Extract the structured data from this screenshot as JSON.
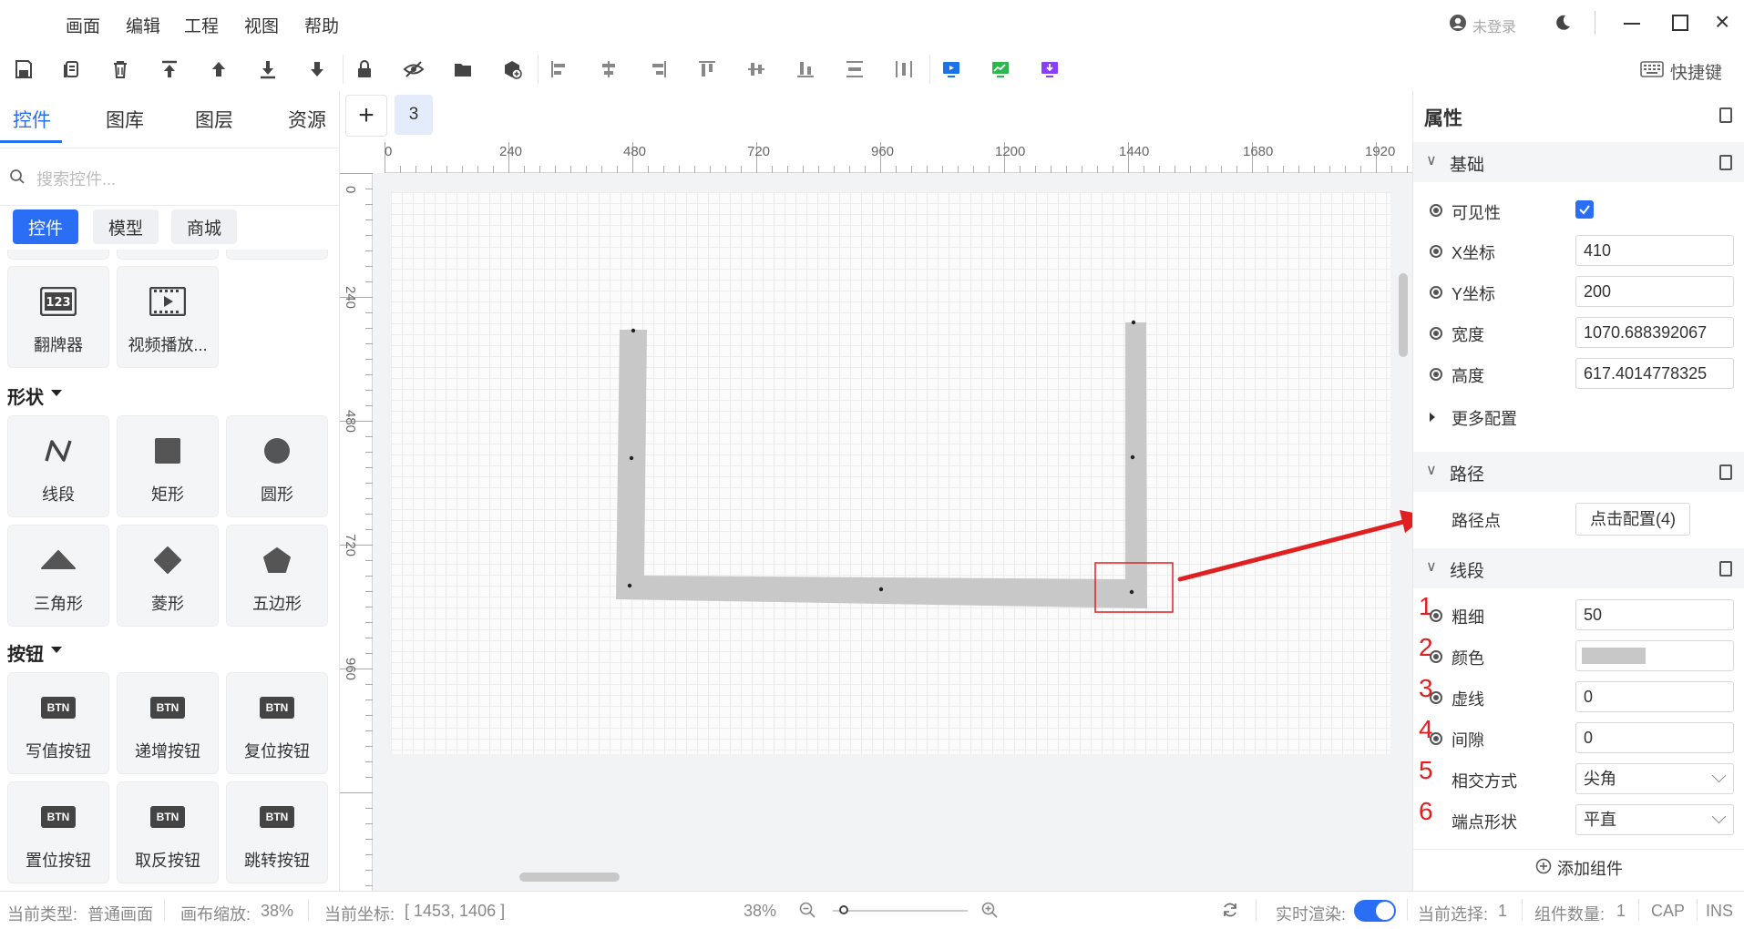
{
  "menu": {
    "items": [
      "画面",
      "编辑",
      "工程",
      "视图",
      "帮助"
    ],
    "user": "未登录"
  },
  "toolbar": {
    "shortcut_label": "快捷键"
  },
  "left_panel": {
    "tabs": [
      "控件",
      "图库",
      "图层",
      "资源"
    ],
    "search_placeholder": "搜索控件...",
    "chips": [
      "控件",
      "模型",
      "商城"
    ],
    "top_tiles": [
      {
        "label": "翻牌器",
        "icon": "flip-counter-icon"
      },
      {
        "label": "视频播放...",
        "icon": "video-player-icon"
      }
    ],
    "shapes_section": "形状",
    "shapes": [
      {
        "label": "线段",
        "icon": "polyline-icon"
      },
      {
        "label": "矩形",
        "icon": "rectangle-icon"
      },
      {
        "label": "圆形",
        "icon": "circle-icon"
      },
      {
        "label": "三角形",
        "icon": "triangle-icon"
      },
      {
        "label": "菱形",
        "icon": "diamond-icon"
      },
      {
        "label": "五边形",
        "icon": "pentagon-icon"
      }
    ],
    "buttons_section": "按钮",
    "buttons": [
      {
        "label": "写值按钮",
        "icon": "write-button-icon"
      },
      {
        "label": "递增按钮",
        "icon": "increment-button-icon"
      },
      {
        "label": "复位按钮",
        "icon": "reset-button-icon"
      },
      {
        "label": "置位按钮",
        "icon": "set-button-icon"
      },
      {
        "label": "取反按钮",
        "icon": "invert-button-icon"
      },
      {
        "label": "跳转按钮",
        "icon": "jump-button-icon"
      }
    ],
    "btn_text": "BTN"
  },
  "canvas": {
    "add_page": "+",
    "page_tab": "3",
    "hruler_ticks": [
      "0",
      "240",
      "480",
      "720",
      "960",
      "1200",
      "1440",
      "1680",
      "1920"
    ],
    "vruler_ticks": [
      "0",
      "240",
      "480",
      "720",
      "960"
    ]
  },
  "right_panel": {
    "title": "属性",
    "basic_section": "基础",
    "visible_label": "可见性",
    "visible": true,
    "x_label": "X坐标",
    "x_value": "410",
    "y_label": "Y坐标",
    "y_value": "200",
    "width_label": "宽度",
    "width_value": "1070.688392067",
    "height_label": "高度",
    "height_value": "617.4014778325",
    "more_config": "更多配置",
    "path_section": "路径",
    "path_points_label": "路径点",
    "path_points_button": "点击配置(4)",
    "segment_section": "线段",
    "thickness_label": "粗细",
    "thickness_value": "50",
    "color_label": "颜色",
    "color_value": "#c8c8c8",
    "dash_label": "虚线",
    "dash_value": "0",
    "gap_label": "间隙",
    "gap_value": "0",
    "join_label": "相交方式",
    "join_value": "尖角",
    "cap_label": "端点形状",
    "cap_value": "平直",
    "annotations": [
      "1",
      "2",
      "3",
      "4",
      "5",
      "6"
    ],
    "add_component": "添加组件"
  },
  "status": {
    "type_label": "当前类型:",
    "type_value": "普通画面",
    "zoom_label": "画布缩放:",
    "zoom_value": "38%",
    "coord_label": "当前坐标:",
    "coord_value": "[ 1453, 1406 ]",
    "zoom_percent": "38%",
    "zoom_slider": 0.08,
    "realtime_label": "实时渲染:",
    "realtime_on": true,
    "selection_label": "当前选择:",
    "selection_value": "1",
    "count_label": "组件数量:",
    "count_value": "1",
    "cap": "CAP",
    "ins": "INS"
  },
  "colors": {
    "accent": "#2a6ef5",
    "annotation": "#e02020",
    "shape_fill": "#c8c8c8"
  }
}
